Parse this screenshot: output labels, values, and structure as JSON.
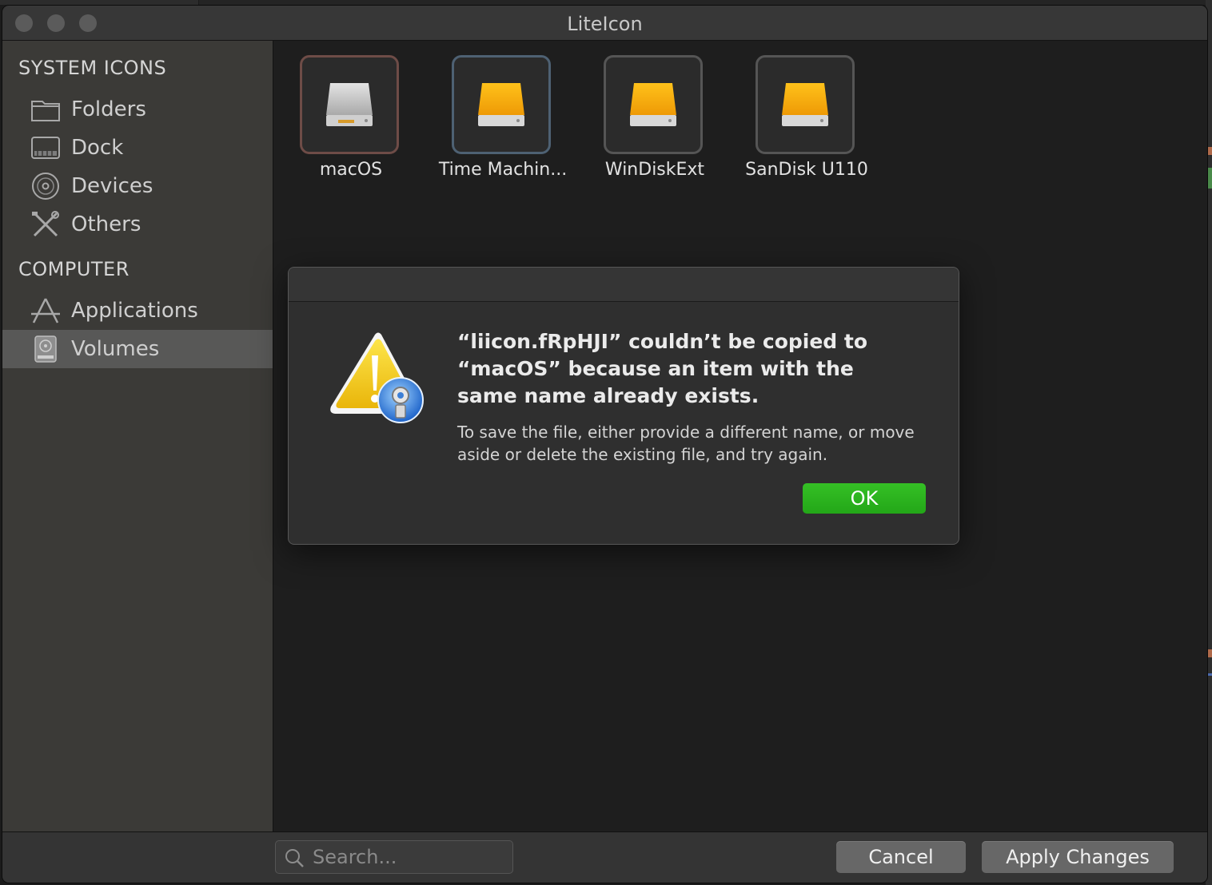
{
  "window": {
    "title": "LiteIcon"
  },
  "sidebar": {
    "sections": [
      {
        "heading": "SYSTEM ICONS",
        "items": [
          "Folders",
          "Dock",
          "Devices",
          "Others"
        ]
      },
      {
        "heading": "COMPUTER",
        "items": [
          "Applications",
          "Volumes"
        ]
      }
    ],
    "selected": "Volumes"
  },
  "icons": [
    {
      "label": "macOS",
      "icon": "internal-drive-icon",
      "color": "#c8c8c8"
    },
    {
      "label": "Time Machin...",
      "icon": "external-drive-icon",
      "color": "#f5a912"
    },
    {
      "label": "WinDiskExt",
      "icon": "external-drive-icon",
      "color": "#f5a912"
    },
    {
      "label": "SanDisk U110",
      "icon": "external-drive-icon",
      "color": "#f5a912"
    }
  ],
  "alert": {
    "title": "“liicon.fRpHJI” couldn’t be copied to “macOS” because an item with the same name already exists.",
    "message": "To save the file, either provide a different name, or move aside or delete the existing file, and try again.",
    "ok_label": "OK",
    "icon": "warning-icon"
  },
  "toolbar": {
    "search_placeholder": "Search...",
    "cancel_label": "Cancel",
    "apply_label": "Apply Changes"
  },
  "colors": {
    "ok_button": "#2bb41e",
    "drive_orange": "#f5a912",
    "sidebar_bg": "#3b3a37"
  }
}
